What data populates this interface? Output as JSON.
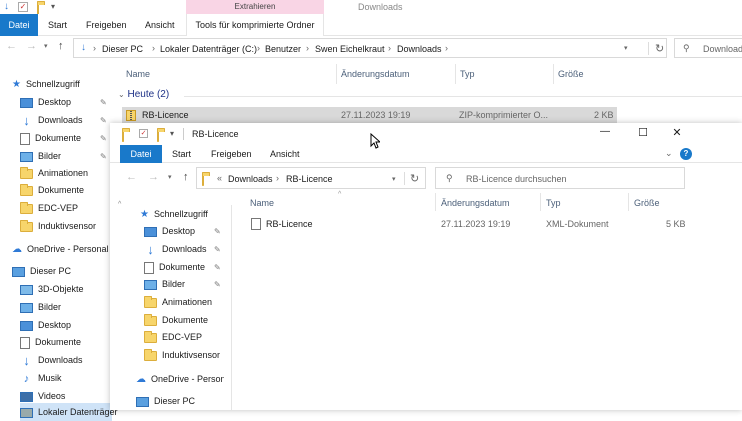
{
  "back_window": {
    "ribbon": {
      "tab_datei": "Datei",
      "tab_start": "Start",
      "tab_freigeben": "Freigeben",
      "tab_ansicht": "Ansicht",
      "context_header": "Extrahieren",
      "context_tab": "Tools für komprimierte Ordner",
      "title": "Downloads"
    },
    "breadcrumb": [
      "Dieser PC",
      "Lokaler Datenträger (C:)",
      "Benutzer",
      "Swen Eichelkraut",
      "Downloads"
    ],
    "search_placeholder": "Download",
    "columns": {
      "name": "Name",
      "date": "Änderungsdatum",
      "type": "Typ",
      "size": "Größe"
    },
    "group": "Heute (2)",
    "file": {
      "name": "RB-Licence",
      "date": "27.11.2023 19:19",
      "type": "ZIP-komprimierter O...",
      "size": "2 KB"
    },
    "nav": {
      "quick": "Schnellzugriff",
      "items": [
        "Desktop",
        "Downloads",
        "Dokumente",
        "Bilder",
        "Animationen",
        "Dokumente",
        "EDC-VEP",
        "Induktivsensor"
      ],
      "onedrive": "OneDrive - Personal",
      "thispc": "Dieser PC",
      "pc_items": [
        "3D-Objekte",
        "Bilder",
        "Desktop",
        "Dokumente",
        "Downloads",
        "Musik",
        "Videos"
      ],
      "partial": "Lokaler Datenträger"
    }
  },
  "front_window": {
    "title": "RB-Licence",
    "ribbon": {
      "tab_datei": "Datei",
      "tab_start": "Start",
      "tab_freigeben": "Freigeben",
      "tab_ansicht": "Ansicht"
    },
    "breadcrumb_prefix": "«",
    "breadcrumb": [
      "Downloads",
      "RB-Licence"
    ],
    "search_placeholder": "RB-Licence durchsuchen",
    "columns": {
      "name": "Name",
      "date": "Änderungsdatum",
      "type": "Typ",
      "size": "Größe"
    },
    "file": {
      "name": "RB-Licence",
      "date": "27.11.2023 19:19",
      "type": "XML-Dokument",
      "size": "5 KB"
    },
    "nav": {
      "quick": "Schnellzugriff",
      "items": [
        "Desktop",
        "Downloads",
        "Dokumente",
        "Bilder",
        "Animationen",
        "Dokumente",
        "EDC-VEP",
        "Induktivsensor"
      ],
      "onedrive": "OneDrive - Person",
      "thispc": "Dieser PC"
    },
    "window_controls": {
      "minimize": "—",
      "maximize": "☐",
      "close": "✕"
    }
  },
  "colors": {
    "accent": "#1979ca",
    "context": "#f9d5e5",
    "selection": "#d9d9d9"
  }
}
